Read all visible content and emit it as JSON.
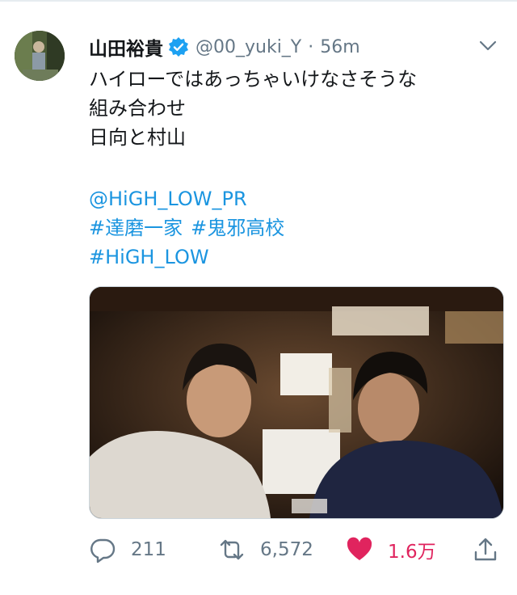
{
  "user": {
    "display_name": "山田裕貴",
    "handle": "@00_yuki_Y",
    "separator": "·",
    "time": "56m",
    "verified": true
  },
  "tweet": {
    "lines": [
      "ハイローではあっちゃいけなさそうな",
      "組み合わせ",
      "日向と村山"
    ],
    "mention": "@HiGH_LOW_PR",
    "hashtags": [
      "#達磨一家",
      "#鬼邪高校",
      "#HiGH_LOW"
    ]
  },
  "actions": {
    "replies": "211",
    "retweets": "6,572",
    "likes": "1.6万",
    "liked": true
  },
  "icons": {
    "reply": "reply-icon",
    "retweet": "retweet-icon",
    "like": "heart-icon",
    "share": "share-icon",
    "menu": "chevron-down-icon"
  },
  "colors": {
    "link": "#1b95e0",
    "verified": "#1da1f2",
    "like": "#e0245e",
    "muted": "#657786"
  }
}
